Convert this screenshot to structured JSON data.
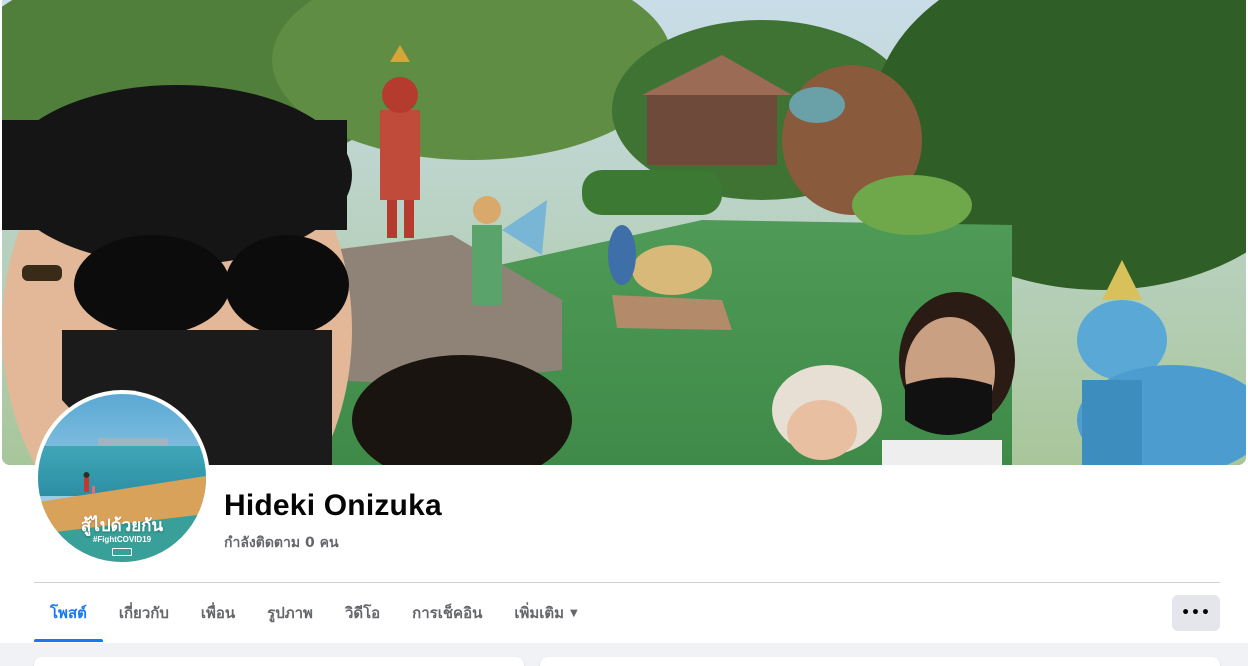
{
  "profile": {
    "name": "Hideki Onizuka",
    "followers_text": "กำลังติดตาม 0 คน"
  },
  "avatar": {
    "slogan": "สู้ไปด้วยกัน",
    "hashtag": "#FightCOVID19",
    "logo_text": "facebook"
  },
  "tabs": [
    {
      "label": "โพสต์",
      "active": true
    },
    {
      "label": "เกี่ยวกับ",
      "active": false
    },
    {
      "label": "เพื่อน",
      "active": false
    },
    {
      "label": "รูปภาพ",
      "active": false
    },
    {
      "label": "วิดีโอ",
      "active": false
    },
    {
      "label": "การเช็คอิน",
      "active": false
    },
    {
      "label": "เพิ่มเติม",
      "active": false,
      "has_caret": true
    }
  ],
  "more_button": {
    "label": "•••"
  },
  "colors": {
    "accent": "#1877f2",
    "text_primary": "#050505",
    "text_secondary": "#65676b",
    "page_background": "#f0f2f5",
    "button_background": "#e4e6eb"
  },
  "icons": {
    "tab_caret": "caret-down-icon",
    "more_options": "more-horizontal-icon"
  }
}
